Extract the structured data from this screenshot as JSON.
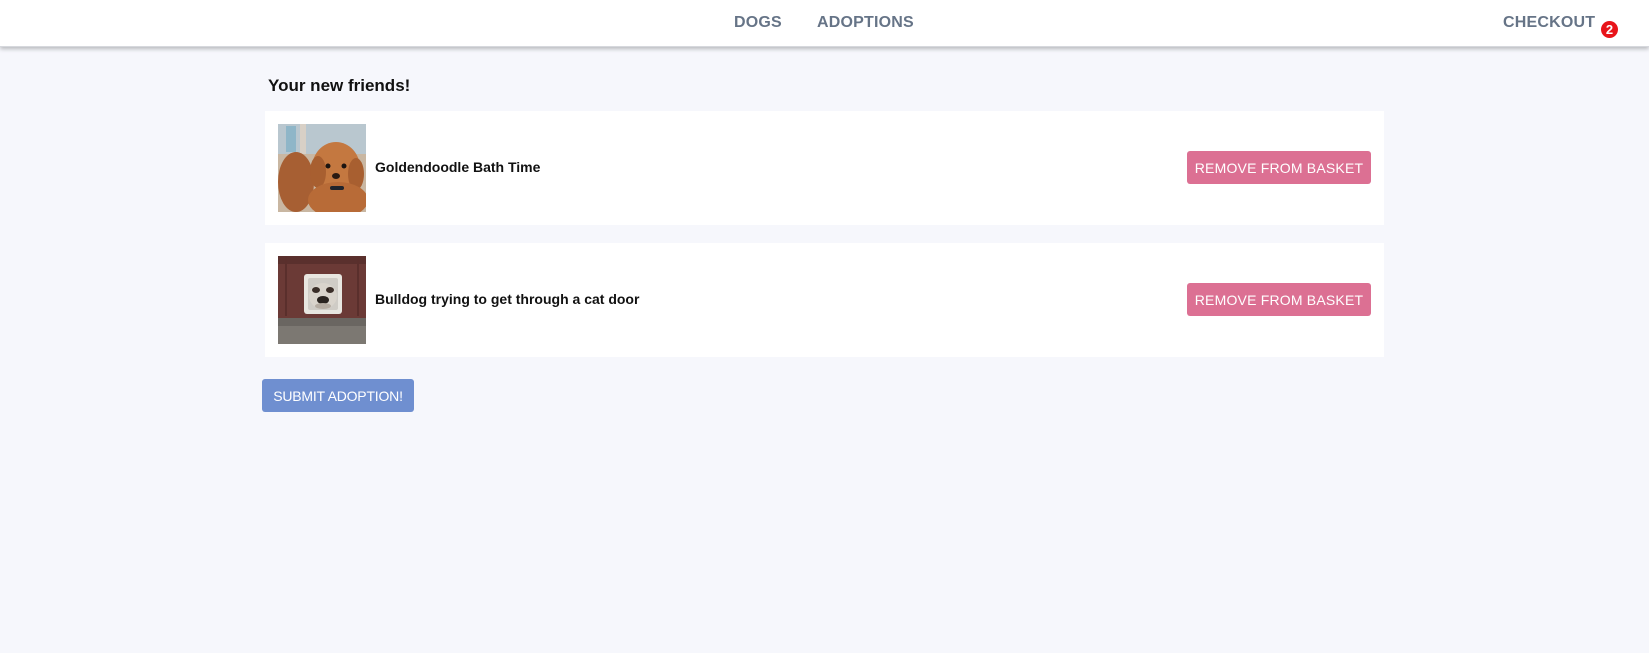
{
  "nav": {
    "dogs_label": "DOGS",
    "adoptions_label": "ADOPTIONS",
    "checkout_label": "CHECKOUT",
    "checkout_count": "2"
  },
  "main": {
    "heading": "Your new friends!",
    "items": [
      {
        "title": "Goldendoodle Bath Time",
        "image_icon": "goldendoodle-photo",
        "remove_label": "REMOVE FROM BASKET"
      },
      {
        "title": "Bulldog trying to get through a cat door",
        "image_icon": "bulldog-photo",
        "remove_label": "REMOVE FROM BASKET"
      }
    ],
    "submit_label": "SUBMIT ADOPTION!"
  },
  "colors": {
    "background": "#f6f7fc",
    "nav_text": "#667487",
    "badge": "#e8141a",
    "remove_button": "#dc7093",
    "submit_button": "#6f8fd0"
  }
}
